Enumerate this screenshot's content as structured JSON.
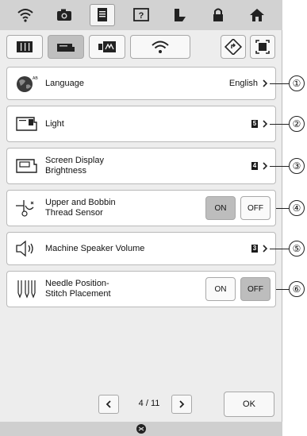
{
  "top_tabs": [
    {
      "icon": "wifi-icon"
    },
    {
      "icon": "camera-icon"
    },
    {
      "icon": "document-icon",
      "active": true
    },
    {
      "icon": "help-icon"
    },
    {
      "icon": "bookmark-icon"
    },
    {
      "icon": "lock-icon"
    },
    {
      "icon": "home-icon"
    }
  ],
  "sub_tabs": [
    {
      "icon": "book-icon"
    },
    {
      "icon": "machine-icon",
      "active": true
    },
    {
      "icon": "embroidery-frame-icon"
    },
    {
      "icon": "wifi-icon"
    },
    {
      "icon": "reset-icon"
    },
    {
      "icon": "screen-capture-icon"
    }
  ],
  "settings": {
    "language": {
      "label": "Language",
      "value": "English",
      "icon": "globe-icon",
      "callout": "①"
    },
    "light": {
      "label": "Light",
      "value": "5",
      "icon": "machine-light-icon",
      "callout": "②"
    },
    "screen_display": {
      "label_line1": "Screen Display",
      "label_line2": "Brightness",
      "value": "4",
      "icon": "machine-screen-icon",
      "callout": "③"
    },
    "thread_sensor": {
      "label_line1": "Upper and Bobbin",
      "label_line2": "Thread Sensor",
      "on_label": "ON",
      "off_label": "OFF",
      "state": "ON",
      "icon": "thread-sensor-icon",
      "callout": "④"
    },
    "speaker_volume": {
      "label": "Machine Speaker Volume",
      "value": "3",
      "icon": "speaker-icon",
      "callout": "⑤"
    },
    "needle_position": {
      "label_line1": "Needle Position-",
      "label_line2": "Stitch Placement",
      "on_label": "ON",
      "off_label": "OFF",
      "state": "OFF",
      "icon": "needle-icon",
      "callout": "⑥"
    }
  },
  "pager": {
    "current": "4",
    "separator": "/",
    "total": "11"
  },
  "ok_label": "OK",
  "colors": {
    "panel_bg": "#ededed",
    "bar_bg": "#d2d2d2",
    "active_toggle": "#bdbdbd"
  }
}
